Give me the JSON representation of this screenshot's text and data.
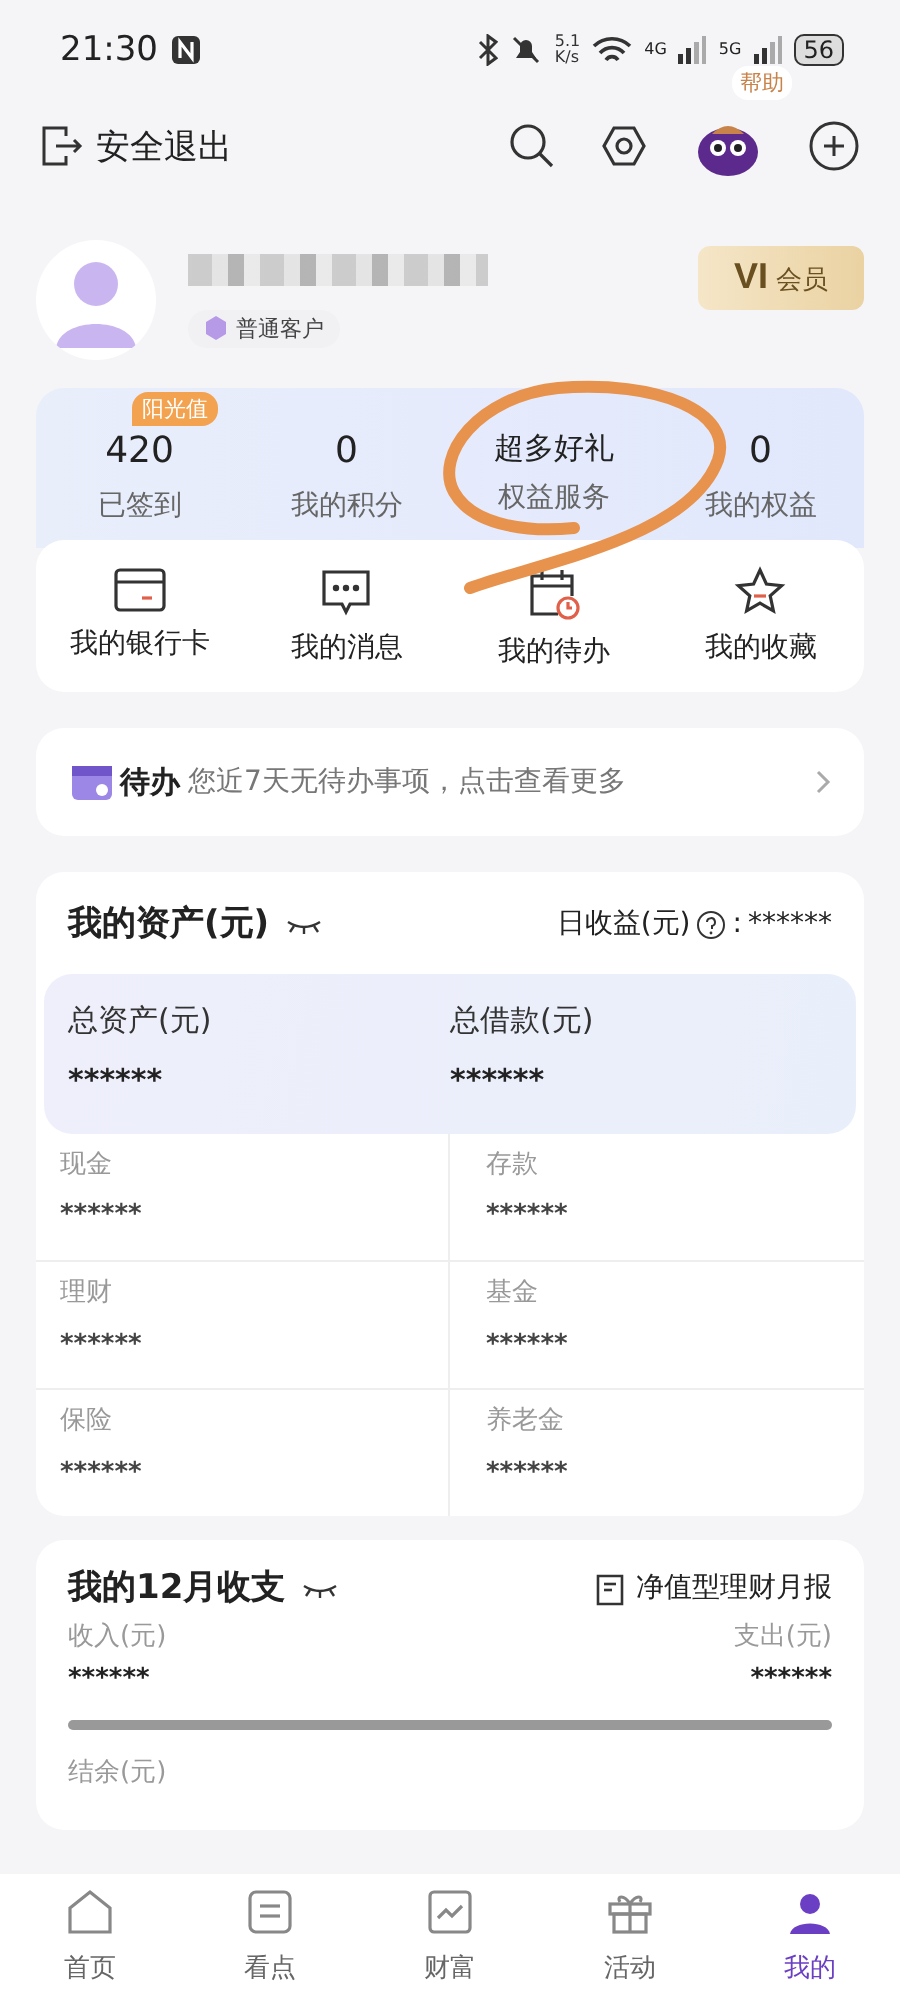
{
  "status_bar": {
    "time": "21:30",
    "net_speed_value": "5.1",
    "net_speed_unit": "K/s",
    "net_4g": "4G",
    "net_5g": "5G",
    "battery": "56"
  },
  "header": {
    "logout": "安全退出",
    "help_bubble": "帮助"
  },
  "profile": {
    "level_tag": "普通客户",
    "vip_level": "VI",
    "vip_label": "会员"
  },
  "stats": [
    {
      "value": "420",
      "label": "已签到",
      "badge": "阳光值"
    },
    {
      "value": "0",
      "label": "我的积分"
    },
    {
      "value": "超多好礼",
      "label": "权益服务"
    },
    {
      "value": "0",
      "label": "我的权益"
    }
  ],
  "shortcuts": [
    {
      "kind": "card",
      "label": "我的银行卡"
    },
    {
      "kind": "message",
      "label": "我的消息"
    },
    {
      "kind": "calendar",
      "label": "我的待办"
    },
    {
      "kind": "star",
      "label": "我的收藏"
    }
  ],
  "todo": {
    "title": "待办",
    "text": "您近7天无待办事项，点击查看更多"
  },
  "assets": {
    "title": "我的资产(元)",
    "daily_label": "日收益(元)",
    "daily_separator": ":",
    "daily_value": "******",
    "totals": [
      {
        "label": "总资产(元)",
        "value": "******"
      },
      {
        "label": "总借款(元)",
        "value": "******"
      }
    ],
    "items": [
      {
        "label": "现金",
        "value": "******"
      },
      {
        "label": "存款",
        "value": "******"
      },
      {
        "label": "理财",
        "value": "******"
      },
      {
        "label": "基金",
        "value": "******"
      },
      {
        "label": "保险",
        "value": "******"
      },
      {
        "label": "养老金",
        "value": "******"
      }
    ]
  },
  "monthly": {
    "title": "我的12月收支",
    "report": "净值型理财月报",
    "income_label": "收入(元)",
    "income_value": "******",
    "expense_label": "支出(元)",
    "expense_value": "******",
    "balance_label": "结余(元)"
  },
  "tabs": [
    {
      "kind": "home",
      "label": "首页",
      "selected": false
    },
    {
      "kind": "news",
      "label": "看点",
      "selected": false
    },
    {
      "kind": "chart",
      "label": "财富",
      "selected": false
    },
    {
      "kind": "gift",
      "label": "活动",
      "selected": false
    },
    {
      "kind": "user",
      "label": "我的",
      "selected": true
    }
  ]
}
